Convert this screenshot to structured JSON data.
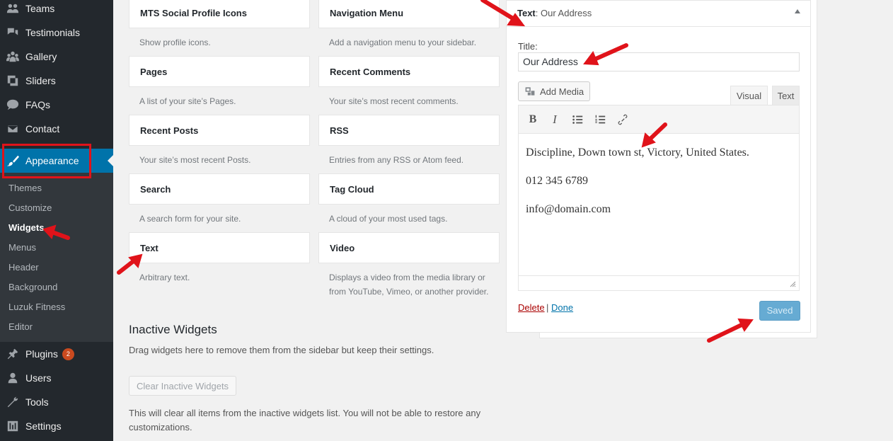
{
  "sidebar": {
    "items": [
      {
        "label": "Teams",
        "icon": "groups-icon"
      },
      {
        "label": "Testimonials",
        "icon": "testimonial-icon"
      },
      {
        "label": "Gallery",
        "icon": "gallery-icon"
      },
      {
        "label": "Sliders",
        "icon": "slides-icon"
      },
      {
        "label": "FAQs",
        "icon": "format-chat-icon"
      },
      {
        "label": "Contact",
        "icon": "email-icon"
      },
      {
        "label": "Appearance",
        "icon": "paintbrush-icon"
      },
      {
        "label": "Plugins",
        "icon": "plugins-icon",
        "badge": "2"
      },
      {
        "label": "Users",
        "icon": "users-icon"
      },
      {
        "label": "Tools",
        "icon": "tools-icon"
      },
      {
        "label": "Settings",
        "icon": "settings-icon"
      }
    ],
    "submenu": [
      "Themes",
      "Customize",
      "Widgets",
      "Menus",
      "Header",
      "Background",
      "Luzuk Fitness",
      "Editor"
    ]
  },
  "available_widgets": [
    {
      "name": "MTS Social Profile Icons",
      "desc": "Show profile icons."
    },
    {
      "name": "Navigation Menu",
      "desc": "Add a navigation menu to your sidebar."
    },
    {
      "name": "Pages",
      "desc": "A list of your site’s Pages."
    },
    {
      "name": "Recent Comments",
      "desc": "Your site’s most recent comments."
    },
    {
      "name": "Recent Posts",
      "desc": "Your site’s most recent Posts."
    },
    {
      "name": "RSS",
      "desc": "Entries from any RSS or Atom feed."
    },
    {
      "name": "Search",
      "desc": "A search form for your site."
    },
    {
      "name": "Tag Cloud",
      "desc": "A cloud of your most used tags."
    },
    {
      "name": "Text",
      "desc": "Arbitrary text."
    },
    {
      "name": "Video",
      "desc_line1": "Displays a video from the media library or",
      "desc_line2": "from YouTube, Vimeo, or another provider."
    }
  ],
  "inactive": {
    "title": "Inactive Widgets",
    "desc": "Drag widgets here to remove them from the sidebar but keep their settings.",
    "clear_button": "Clear Inactive Widgets",
    "note": "This will clear all items from the inactive widgets list. You will not be able to restore any customizations."
  },
  "text_widget": {
    "header_prefix": "Text",
    "header_title": ": Our Address",
    "title_label": "Title:",
    "title_value": "Our Address",
    "add_media": "Add Media",
    "tab_visual": "Visual",
    "tab_text": "Text",
    "toolbar_bold": "B",
    "toolbar_italic": "I",
    "content": [
      "Discipline, Down town st, Victory, United States.",
      "012 345 6789",
      "info@domain.com"
    ],
    "delete_link": "Delete",
    "separator": "|",
    "done_link": "Done",
    "saved_button": "Saved"
  },
  "colors": {
    "sidebar_bg": "#23282d",
    "submenu_bg": "#32373c",
    "accent": "#0073aa",
    "annotation_red": "#e0131a",
    "badge": "#ca4a1f"
  }
}
